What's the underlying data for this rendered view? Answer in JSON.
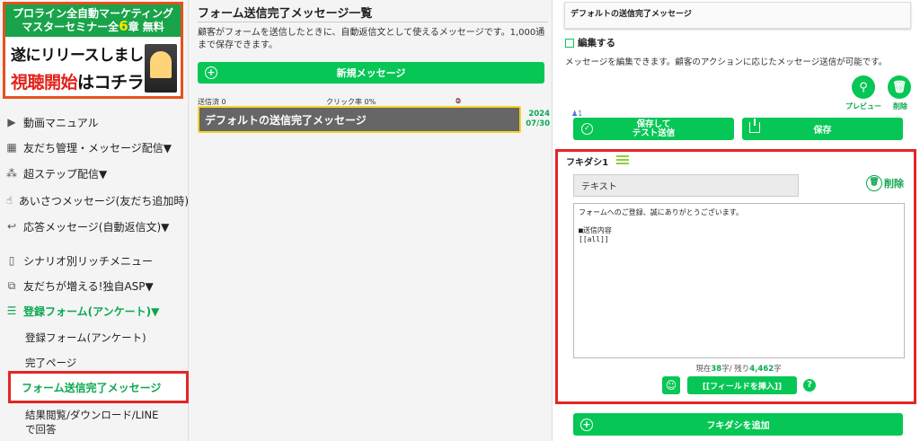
{
  "banner": {
    "line1": "プロライン全自動マーケティング",
    "line2_pre": "マスターセミナー全",
    "line2_num": "6",
    "line2_post": "章 無料",
    "line3": "遂にリリースしました!",
    "line4_red": "視聴開始",
    "line4_post": "はコチラ!"
  },
  "sidebar": {
    "items": [
      {
        "label": "動画マニュアル",
        "icon": "▶"
      },
      {
        "label": "友だち管理・メッセージ配信▼",
        "icon": "▦"
      },
      {
        "label": "超ステップ配信▼",
        "icon": "⁂"
      },
      {
        "label": "あいさつメッセージ(友だち追加時)",
        "icon": "☝"
      },
      {
        "label": "応答メッセージ(自動返信文)▼",
        "icon": "↩"
      },
      {
        "label": "シナリオ別リッチメニュー",
        "icon": "▯"
      },
      {
        "label": "友だちが増える!独自ASP▼",
        "icon": "⧉"
      },
      {
        "label": "登録フォーム(アンケート)▼",
        "icon": "☰"
      }
    ],
    "sub_items": [
      {
        "label": "登録フォーム(アンケート)"
      },
      {
        "label": "完了ページ"
      },
      {
        "label": "フォーム送信完了メッセージ"
      },
      {
        "label": "結果閲覧/ダウンロード/LINE"
      },
      {
        "label": "で回答"
      }
    ]
  },
  "list": {
    "title": "フォーム送信完了メッセージ一覧",
    "desc": "顧客がフォームを送信したときに、自動返信文として使えるメッセージです。1,000通まで保存できます。",
    "new_button": "新規メッセージ",
    "stats": {
      "sent": "送信済 0",
      "click": "クリック率 0%",
      "blocked": "0"
    },
    "item": {
      "name": "デフォルトの送信完了メッセージ",
      "date_year": "2024",
      "date_md": "07/30"
    }
  },
  "editor": {
    "name_value": "デフォルトの送信完了メッセージ",
    "edit_checkbox": "編集する",
    "desc": "メッセージを編集できます。顧客のアクションに応じたメッセージ送信が可能です。",
    "preview_label": "プレビュー",
    "delete_label": "削除",
    "friend_count": "1",
    "test_button_line1": "保存して",
    "test_button_line2": "テスト送信",
    "save_button": "保存",
    "bubble": {
      "label": "フキダシ1",
      "type": "テキスト",
      "delete": "削除",
      "text": "フォームへのご登録、誠にありがとうございます。\n\n■送信内容\n[[all]]",
      "count_prefix": "現在",
      "count_current": "38",
      "count_mid": "字/ 残り",
      "count_remaining": "4,462",
      "count_suffix": "字",
      "insert_field": "[[フィールドを挿入]]"
    },
    "add_bubble": "フキダシを追加"
  },
  "colors": {
    "accent": "#06c755",
    "highlight": "#e32525",
    "selected_item": "#666666",
    "selected_border": "#f2d42a"
  }
}
